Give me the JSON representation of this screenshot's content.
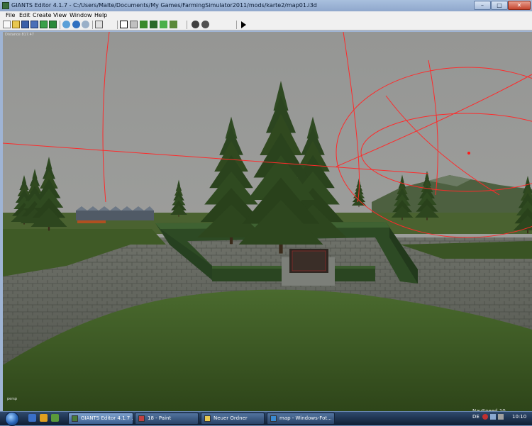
{
  "window": {
    "title": "GIANTS Editor 4.1.7 - C:/Users/Malte/Documents/My Games/FarmingSimulator2011/mods/karte2/map01.i3d",
    "controls": {
      "minimize": "–",
      "maximize": "□",
      "close": "✕"
    }
  },
  "menu": [
    "File",
    "Edit",
    "Create",
    "View",
    "Window",
    "Help"
  ],
  "toolbar_icons": [
    "new-icon",
    "open-icon",
    "save-icon",
    "save-as-icon",
    "import-icon",
    "export-icon",
    "refresh-icon",
    "undo-icon",
    "redo-icon",
    "select-icon",
    "move-icon",
    "terrain-sculpt-icon",
    "terrain-paint-icon",
    "foliage-paint-icon",
    "foliage-erase-icon",
    "grid-icon",
    "snap-icon",
    "play-icon"
  ],
  "viewport": {
    "distance_label": "Distance 817.47",
    "nav_speed": "NavSpeed 10",
    "corner_label": "persp"
  },
  "taskbar": {
    "tasks": [
      {
        "label": "GIANTS Editor 4.1.7 ...",
        "icon_color": "#4a7a3a",
        "active": true
      },
      {
        "label": "18 - Paint",
        "icon_color": "#c04040",
        "active": false
      },
      {
        "label": "Neuer Ordner",
        "icon_color": "#e8c850",
        "active": false
      },
      {
        "label": "map - Windows-Fot...",
        "icon_color": "#3a8ad0",
        "active": false
      }
    ],
    "language": "DE",
    "clock": "10:10"
  },
  "colors": {
    "sky": "#9a9a98",
    "gizmo": "#ff2a2a",
    "grass": "#3b5424",
    "cobble": "#5a5e55"
  }
}
